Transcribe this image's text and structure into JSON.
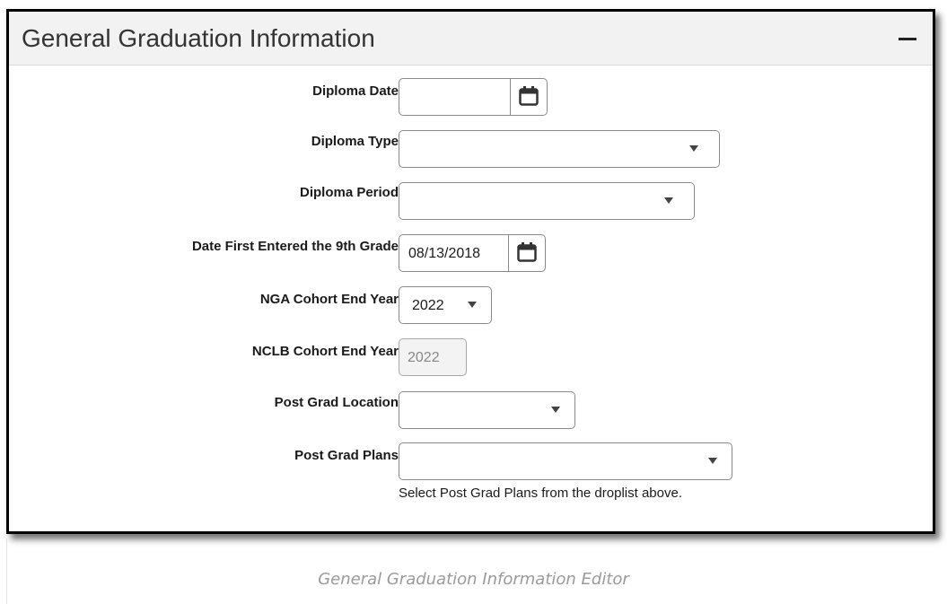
{
  "panel": {
    "title": "General Graduation Information",
    "collapse_icon": "minus-icon"
  },
  "fields": {
    "diploma_date": {
      "label": "Diploma Date:",
      "value": "",
      "icon": "calendar-icon"
    },
    "diploma_type": {
      "label": "Diploma Type:",
      "value": ""
    },
    "diploma_period": {
      "label": "Diploma Period:",
      "value": ""
    },
    "date_first_9th": {
      "label": "Date First Entered the 9th Grade:",
      "value": "08/13/2018",
      "icon": "calendar-icon"
    },
    "nga_cohort": {
      "label": "NGA Cohort End Year:",
      "value": "2022"
    },
    "nclb_cohort": {
      "label": "NCLB Cohort End Year:",
      "value": "2022"
    },
    "post_grad_location": {
      "label": "Post Grad Location:",
      "value": ""
    },
    "post_grad_plans": {
      "label": "Post Grad Plans:",
      "value": "",
      "helper": "Select Post Grad Plans from the droplist above."
    }
  },
  "caption": "General Graduation Information Editor",
  "colors": {
    "border": "#000000",
    "header_bg": "#f2f2f2",
    "caption": "#9a9a9a"
  }
}
